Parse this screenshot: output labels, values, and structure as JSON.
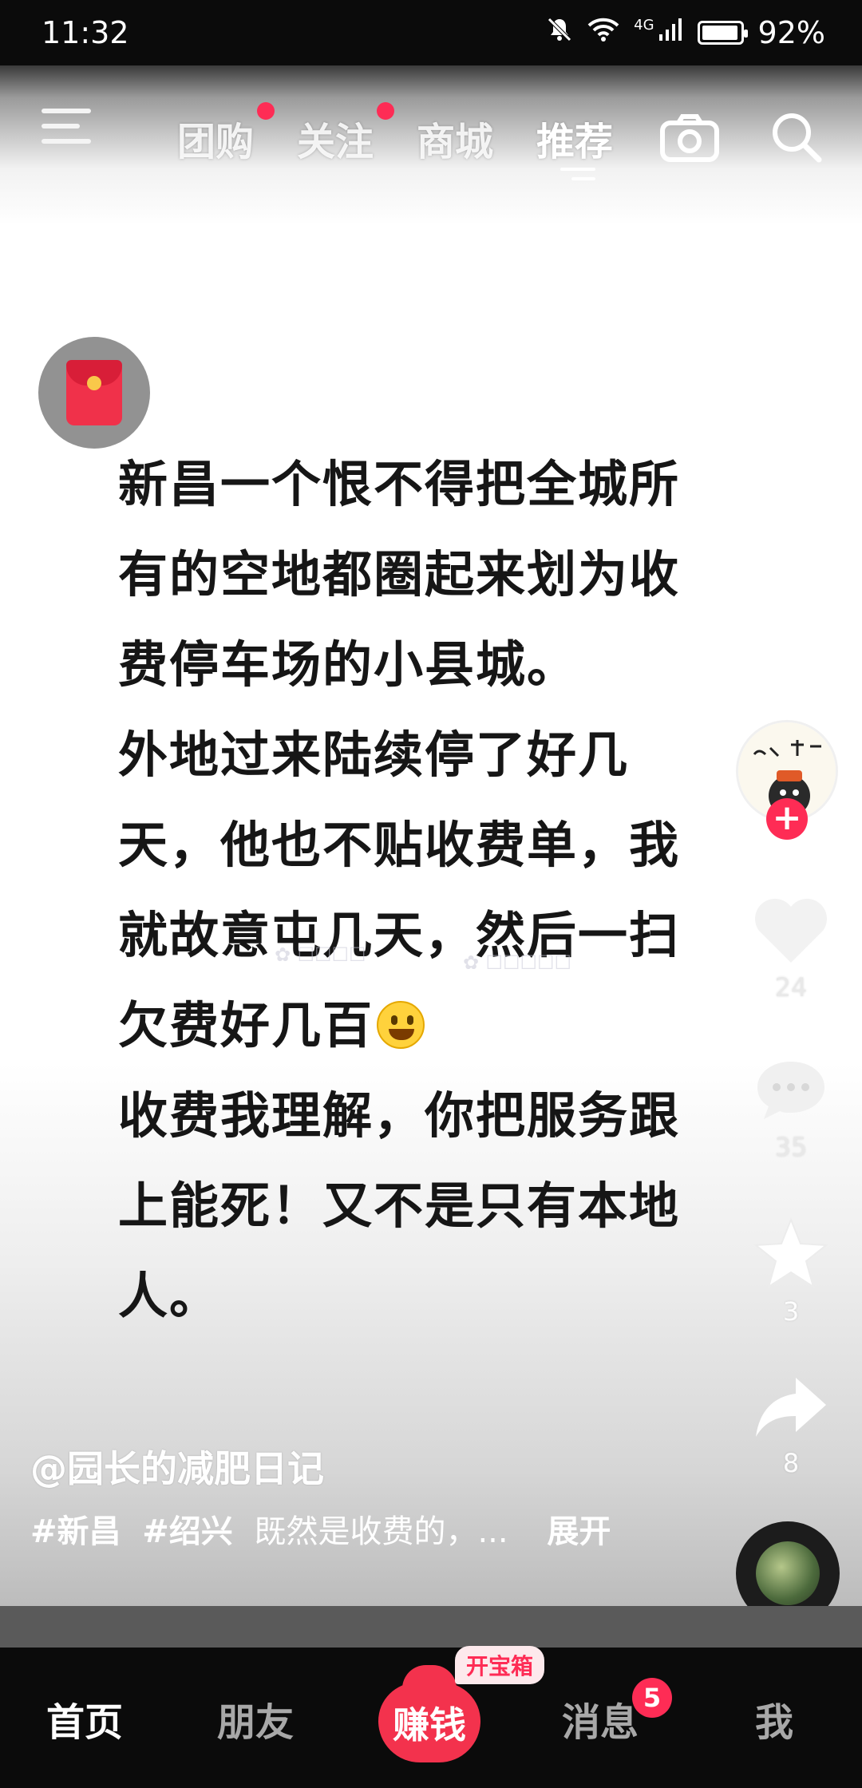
{
  "status_bar": {
    "time": "11:32",
    "network": "4G",
    "battery_percent": "92%",
    "battery_level": 0.92,
    "icons": [
      "mute-bell-icon",
      "wifi-icon",
      "signal-icon",
      "battery-icon"
    ]
  },
  "top_nav": {
    "tabs": [
      {
        "label": "团购",
        "dot": true
      },
      {
        "label": "关注",
        "dot": true
      },
      {
        "label": "商城",
        "dot": false
      },
      {
        "label": "推荐",
        "active": true
      }
    ],
    "icons": [
      "menu-icon",
      "camera-icon",
      "search-icon"
    ]
  },
  "post": {
    "lines": [
      "新昌一个恨不得把全城所",
      "有的空地都圈起来划为收",
      "费停车场的小县城。",
      "外地过来陆续停了好几",
      "天，他也不贴收费单，我",
      "就故意屯几天，然后一扫",
      "欠费好几百",
      "收费我理解，你把服务跟",
      "上能死！又不是只有本地",
      "人。"
    ]
  },
  "actions": {
    "likes": "24",
    "comments": "35",
    "favorites": "3",
    "shares": "8"
  },
  "caption": {
    "author": "@园长的减肥日记",
    "tags": [
      "#新昌",
      "#绍兴"
    ],
    "text": "既然是收费的，...",
    "expand": "展开"
  },
  "bottom_nav": {
    "home": "首页",
    "friends": "朋友",
    "earn": "赚钱",
    "treasure": "开宝箱",
    "messages": "消息",
    "message_badge": "5",
    "me": "我"
  },
  "colors": {
    "accent": "#fe2c55",
    "bar_bg": "#0b0b0b"
  }
}
